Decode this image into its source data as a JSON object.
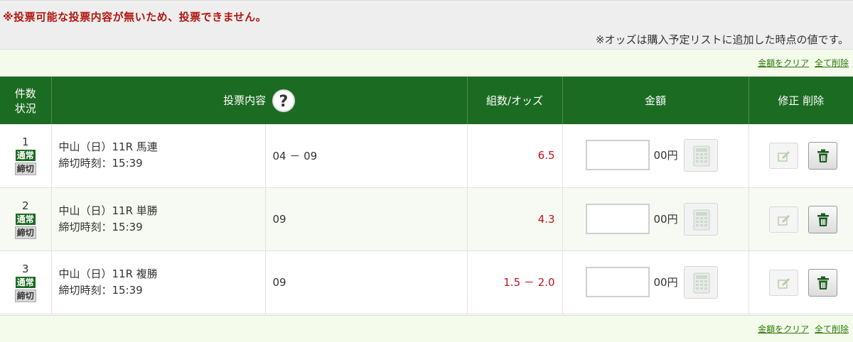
{
  "alert": {
    "message": "※投票可能な投票内容が無いため、投票できません。",
    "odds_note": "※オッズは購入予定リストに追加した時点の値です。"
  },
  "actions": {
    "clear_amount": "金額をクリア",
    "delete_all": "全て削除"
  },
  "table": {
    "headers": {
      "count_status_line1": "件数",
      "count_status_line2": "状況",
      "bet_content": "投票内容",
      "combo_odds": "組数/オッズ",
      "amount": "金額",
      "edit_delete": "修正 削除"
    },
    "help_icon_label": "?",
    "rows": [
      {
        "number": "1",
        "status": "通常",
        "deadline_badge": "締切",
        "race": "中山（日）11R 馬連",
        "deadline": "締切時刻：15:39",
        "combination": "04 － 09",
        "odds": "6.5",
        "amount_value": "",
        "unit": "00円"
      },
      {
        "number": "2",
        "status": "通常",
        "deadline_badge": "締切",
        "race": "中山（日）11R 単勝",
        "deadline": "締切時刻：15:39",
        "combination": "09",
        "odds": "4.3",
        "amount_value": "",
        "unit": "00円"
      },
      {
        "number": "3",
        "status": "通常",
        "deadline_badge": "締切",
        "race": "中山（日）11R 複勝",
        "deadline": "締切時刻：15:39",
        "combination": "09",
        "odds": "1.5 － 2.0",
        "amount_value": "",
        "unit": "00円"
      }
    ]
  },
  "icons": {
    "help": "question-icon",
    "calculator": "calculator-icon",
    "edit": "edit-icon",
    "delete": "trash-icon"
  },
  "colors": {
    "header_green": "#1c6b22",
    "alert_red": "#b3160f",
    "odds_red": "#c0121b",
    "link_green": "#2b7a0b"
  }
}
